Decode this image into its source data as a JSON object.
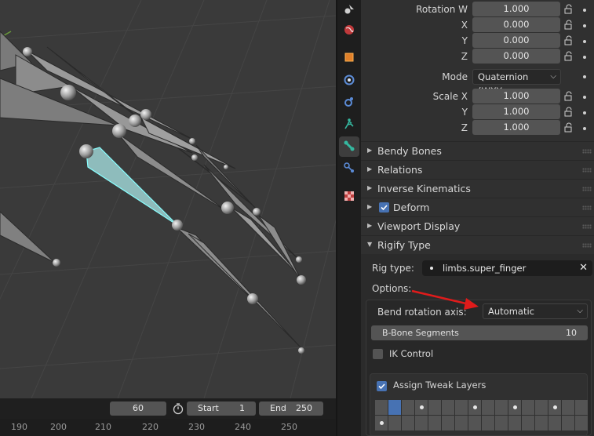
{
  "timeline": {
    "current_frame": "60",
    "start_label": "Start",
    "start_value": "1",
    "end_label": "End",
    "end_value": "250",
    "ruler_ticks": [
      "190",
      "200",
      "210",
      "220",
      "230",
      "240",
      "250"
    ]
  },
  "tabs": [
    {
      "icon": "tool-icon"
    },
    {
      "icon": "world-icon"
    },
    {
      "icon": "object-icon"
    },
    {
      "icon": "modifier-icon"
    },
    {
      "icon": "physics-icon"
    },
    {
      "icon": "armature-data-icon"
    },
    {
      "icon": "bone-icon",
      "active": true
    },
    {
      "icon": "bone-constraint-icon"
    },
    {
      "icon": "texture-icon"
    }
  ],
  "transform": {
    "rotation_w_label": "Rotation W",
    "rotation_w": "1.000",
    "rotation_x_label": "X",
    "rotation_x": "0.000",
    "rotation_y_label": "Y",
    "rotation_y": "0.000",
    "rotation_z_label": "Z",
    "rotation_z": "0.000",
    "mode_label": "Mode",
    "mode_value": "Quaternion (WXY...",
    "scale_x_label": "Scale X",
    "scale_x": "1.000",
    "scale_y_label": "Y",
    "scale_y": "1.000",
    "scale_z_label": "Z",
    "scale_z": "1.000"
  },
  "sections": {
    "bendy_bones": "Bendy Bones",
    "relations": "Relations",
    "inverse_kinematics": "Inverse Kinematics",
    "deform": "Deform",
    "deform_checked": true,
    "viewport_display": "Viewport Display",
    "rigify_type": "Rigify Type"
  },
  "rigify": {
    "rig_type_label": "Rig type:",
    "rig_type_value": "limbs.super_finger",
    "options_label": "Options:",
    "bend_axis_label": "Bend rotation axis:",
    "bend_axis_value": "Automatic",
    "bbone_label": "B-Bone Segments",
    "bbone_value": "10",
    "ik_control_label": "IK Control",
    "ik_control_checked": false,
    "assign_tweak_label": "Assign Tweak Layers",
    "assign_tweak_checked": true
  },
  "colors": {
    "accent": "#4772b3",
    "selected_bone": "#7fc7c7",
    "annotation_arrow": "#e01b1b"
  }
}
